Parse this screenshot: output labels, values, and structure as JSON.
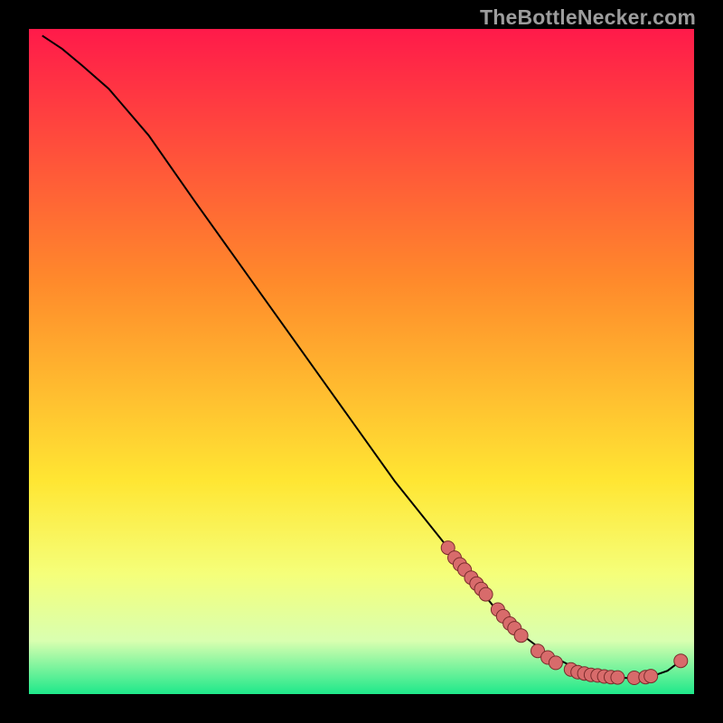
{
  "watermark": {
    "text": "TheBottleNecker.com"
  },
  "colors": {
    "line": "#000000",
    "dot_fill": "#d86b6b",
    "dot_stroke": "#7a2c2c",
    "gradient": {
      "top": "#ff1a4a",
      "mid_upper": "#ff8a2b",
      "mid": "#ffe633",
      "lower_band_top": "#f5ff7a",
      "lower_band_mid": "#d9ffb0",
      "bottom": "#1ee88a"
    }
  },
  "chart_data": {
    "type": "line",
    "title": "",
    "xlabel": "",
    "ylabel": "",
    "xlim": [
      0,
      100
    ],
    "ylim": [
      0,
      100
    ],
    "series": [
      {
        "name": "curve",
        "x": [
          2,
          5,
          8,
          12,
          18,
          25,
          35,
          45,
          55,
          63,
          66,
          70,
          74,
          78,
          82,
          85,
          88,
          90,
          92,
          94,
          96,
          98
        ],
        "y": [
          99,
          97,
          94.5,
          91,
          84,
          74,
          60,
          46,
          32,
          22,
          18,
          13,
          9,
          6,
          4,
          3,
          2.5,
          2.4,
          2.5,
          2.8,
          3.5,
          5
        ]
      }
    ],
    "dots": [
      {
        "x": 63.0,
        "y": 22.0
      },
      {
        "x": 64.0,
        "y": 20.5
      },
      {
        "x": 64.8,
        "y": 19.5
      },
      {
        "x": 65.5,
        "y": 18.7
      },
      {
        "x": 66.5,
        "y": 17.5
      },
      {
        "x": 67.3,
        "y": 16.6
      },
      {
        "x": 68.0,
        "y": 15.8
      },
      {
        "x": 68.7,
        "y": 15.0
      },
      {
        "x": 70.5,
        "y": 12.7
      },
      {
        "x": 71.3,
        "y": 11.7
      },
      {
        "x": 72.3,
        "y": 10.6
      },
      {
        "x": 73.0,
        "y": 9.9
      },
      {
        "x": 74.0,
        "y": 8.8
      },
      {
        "x": 76.5,
        "y": 6.5
      },
      {
        "x": 78.0,
        "y": 5.5
      },
      {
        "x": 79.2,
        "y": 4.7
      },
      {
        "x": 81.5,
        "y": 3.7
      },
      {
        "x": 82.5,
        "y": 3.3
      },
      {
        "x": 83.5,
        "y": 3.1
      },
      {
        "x": 84.5,
        "y": 2.9
      },
      {
        "x": 85.5,
        "y": 2.8
      },
      {
        "x": 86.5,
        "y": 2.65
      },
      {
        "x": 87.5,
        "y": 2.55
      },
      {
        "x": 88.5,
        "y": 2.5
      },
      {
        "x": 91.0,
        "y": 2.45
      },
      {
        "x": 92.7,
        "y": 2.55
      },
      {
        "x": 93.5,
        "y": 2.7
      },
      {
        "x": 98.0,
        "y": 5.0
      }
    ]
  }
}
